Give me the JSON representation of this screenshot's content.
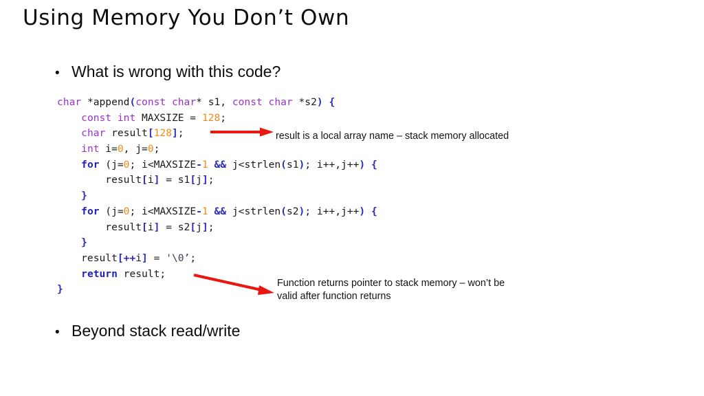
{
  "slide": {
    "title": "Using Memory You Don’t Own",
    "bullets": [
      {
        "marker": "•",
        "text": "What is wrong with this code?"
      },
      {
        "marker": "•",
        "text": "Beyond stack read/write"
      }
    ]
  },
  "code": {
    "language": "c",
    "lines": [
      [
        {
          "t": "char",
          "c": "kw-type"
        },
        {
          "t": " *append",
          "c": "plain"
        },
        {
          "t": "(",
          "c": "punc"
        },
        {
          "t": "const char",
          "c": "kw-type"
        },
        {
          "t": "* s1, ",
          "c": "plain"
        },
        {
          "t": "const char",
          "c": "kw-type"
        },
        {
          "t": " *s2",
          "c": "plain"
        },
        {
          "t": ")",
          "c": "punc"
        },
        {
          "t": " {",
          "c": "punc"
        }
      ],
      [
        {
          "t": "    ",
          "c": "plain"
        },
        {
          "t": "const int",
          "c": "kw-type"
        },
        {
          "t": " MAXSIZE = ",
          "c": "plain"
        },
        {
          "t": "128",
          "c": "num"
        },
        {
          "t": ";",
          "c": "plain"
        }
      ],
      [
        {
          "t": "    ",
          "c": "plain"
        },
        {
          "t": "char",
          "c": "kw-type"
        },
        {
          "t": " result",
          "c": "plain"
        },
        {
          "t": "[",
          "c": "punc"
        },
        {
          "t": "128",
          "c": "num"
        },
        {
          "t": "]",
          "c": "punc"
        },
        {
          "t": ";",
          "c": "plain"
        }
      ],
      [
        {
          "t": "    ",
          "c": "plain"
        },
        {
          "t": "int",
          "c": "kw-type"
        },
        {
          "t": " i=",
          "c": "plain"
        },
        {
          "t": "0",
          "c": "num"
        },
        {
          "t": ", j=",
          "c": "plain"
        },
        {
          "t": "0",
          "c": "num"
        },
        {
          "t": ";",
          "c": "plain"
        }
      ],
      [
        {
          "t": "    ",
          "c": "plain"
        },
        {
          "t": "for",
          "c": "kw-ctrl"
        },
        {
          "t": " (j=",
          "c": "plain"
        },
        {
          "t": "0",
          "c": "num"
        },
        {
          "t": "; i<MAXSIZE",
          "c": "plain"
        },
        {
          "t": "-",
          "c": "punc"
        },
        {
          "t": "1",
          "c": "num"
        },
        {
          "t": " ",
          "c": "plain"
        },
        {
          "t": "&&",
          "c": "punc"
        },
        {
          "t": " j<strlen",
          "c": "plain"
        },
        {
          "t": "(",
          "c": "punc"
        },
        {
          "t": "s1",
          "c": "plain"
        },
        {
          "t": ")",
          "c": "punc"
        },
        {
          "t": "; i++,j++",
          "c": "plain"
        },
        {
          "t": ")",
          "c": "punc"
        },
        {
          "t": " {",
          "c": "punc"
        }
      ],
      [
        {
          "t": "        result",
          "c": "plain"
        },
        {
          "t": "[",
          "c": "punc"
        },
        {
          "t": "i",
          "c": "plain"
        },
        {
          "t": "]",
          "c": "punc"
        },
        {
          "t": " = s1",
          "c": "plain"
        },
        {
          "t": "[",
          "c": "punc"
        },
        {
          "t": "j",
          "c": "plain"
        },
        {
          "t": "]",
          "c": "punc"
        },
        {
          "t": ";",
          "c": "plain"
        }
      ],
      [
        {
          "t": "    ",
          "c": "plain"
        },
        {
          "t": "}",
          "c": "punc"
        }
      ],
      [
        {
          "t": "    ",
          "c": "plain"
        },
        {
          "t": "for",
          "c": "kw-ctrl"
        },
        {
          "t": " (j=",
          "c": "plain"
        },
        {
          "t": "0",
          "c": "num"
        },
        {
          "t": "; i<MAXSIZE",
          "c": "plain"
        },
        {
          "t": "-",
          "c": "punc"
        },
        {
          "t": "1",
          "c": "num"
        },
        {
          "t": " ",
          "c": "plain"
        },
        {
          "t": "&&",
          "c": "punc"
        },
        {
          "t": " j<strlen",
          "c": "plain"
        },
        {
          "t": "(",
          "c": "punc"
        },
        {
          "t": "s2",
          "c": "plain"
        },
        {
          "t": ")",
          "c": "punc"
        },
        {
          "t": "; i++,j++",
          "c": "plain"
        },
        {
          "t": ")",
          "c": "punc"
        },
        {
          "t": " {",
          "c": "punc"
        }
      ],
      [
        {
          "t": "        result",
          "c": "plain"
        },
        {
          "t": "[",
          "c": "punc"
        },
        {
          "t": "i",
          "c": "plain"
        },
        {
          "t": "]",
          "c": "punc"
        },
        {
          "t": " = s2",
          "c": "plain"
        },
        {
          "t": "[",
          "c": "punc"
        },
        {
          "t": "j",
          "c": "plain"
        },
        {
          "t": "]",
          "c": "punc"
        },
        {
          "t": ";",
          "c": "plain"
        }
      ],
      [
        {
          "t": "    ",
          "c": "plain"
        },
        {
          "t": "}",
          "c": "punc"
        }
      ],
      [
        {
          "t": "    result",
          "c": "plain"
        },
        {
          "t": "[",
          "c": "punc"
        },
        {
          "t": "++",
          "c": "punc"
        },
        {
          "t": "i",
          "c": "plain"
        },
        {
          "t": "]",
          "c": "punc"
        },
        {
          "t": " = ",
          "c": "plain"
        },
        {
          "t": "'\\0’",
          "c": "chr"
        },
        {
          "t": ";",
          "c": "plain"
        }
      ],
      [
        {
          "t": "    ",
          "c": "plain"
        },
        {
          "t": "return",
          "c": "kw-ctrl"
        },
        {
          "t": " result;",
          "c": "plain"
        }
      ],
      [
        {
          "t": "}",
          "c": "punc"
        }
      ]
    ]
  },
  "annotations": {
    "local_array": "result is a local array name – stack memory allocated",
    "returns_pointer_line1": "Function returns pointer to stack memory – won’t be",
    "returns_pointer_line2": "valid after function returns"
  },
  "colors": {
    "arrow": "#e8170f",
    "keyword_type": "#9a32cd",
    "keyword_control": "#2020c0",
    "number": "#ef8a17",
    "punctuation": "#2b2bb5",
    "text": "#0d0d0d",
    "background": "#ffffff"
  }
}
